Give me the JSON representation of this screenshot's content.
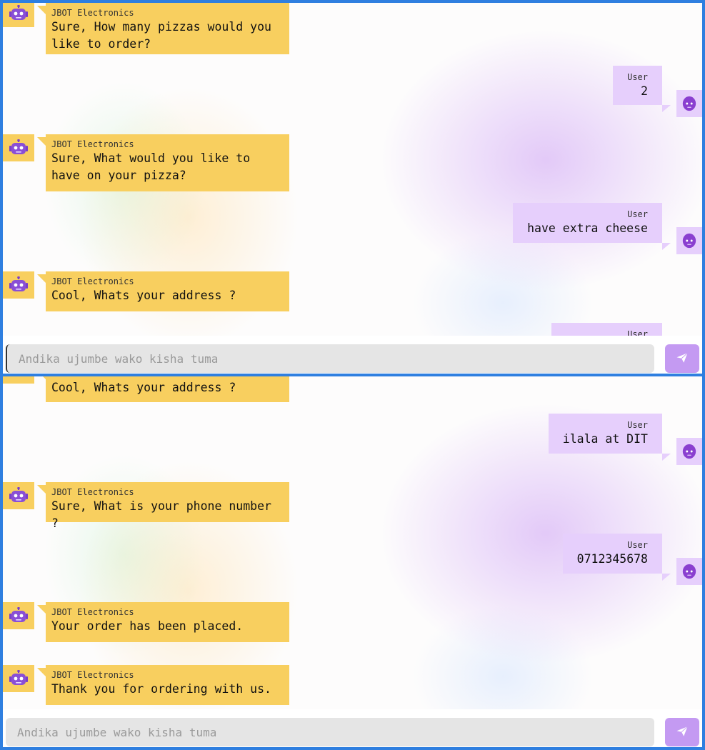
{
  "bot_name": "JBOT Electronics",
  "user_name": "User",
  "input_placeholder": "Andika ujumbe wako kisha tuma",
  "panel1": {
    "bot1": "Sure, How many pizzas would you like to order?",
    "user1": "2",
    "bot2": "Sure, What would you like to have on your pizza?",
    "user2": "have extra cheese",
    "bot3": "Cool, Whats your address ?"
  },
  "panel2": {
    "bot3": "Cool, Whats your address ?",
    "user3": "ilala at DIT",
    "bot4": "Sure, What is your phone number ?",
    "user4": "0712345678",
    "bot5": "Your order has been placed.",
    "bot6": "Thank you for ordering with us."
  },
  "colors": {
    "bot": "#f8cf5f",
    "user": "#e6cffc",
    "send": "#c49af2",
    "frame": "#2f7fe0"
  },
  "icons": {
    "bot_avatar": "robot-icon",
    "user_avatar": "user-head-icon",
    "send": "send-icon"
  }
}
